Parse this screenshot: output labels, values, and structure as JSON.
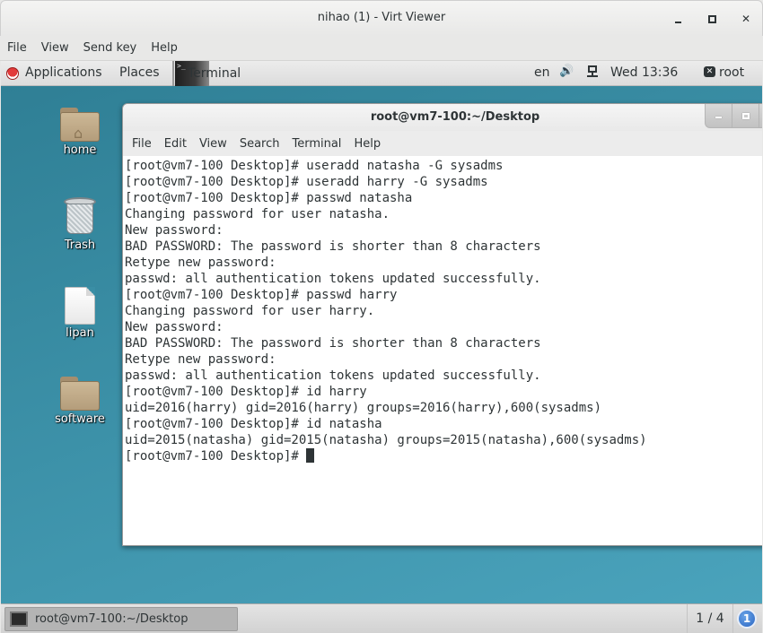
{
  "viewer": {
    "title": "nihao (1) - Virt Viewer",
    "menu": [
      "File",
      "View",
      "Send key",
      "Help"
    ],
    "controls": {
      "minimize": "minimize",
      "maximize": "maximize",
      "close": "close"
    }
  },
  "topbar": {
    "applications": "Applications",
    "places": "Places",
    "active_app": "Terminal",
    "terminal_icon_glyph": ">_",
    "language": "en",
    "clock": "Wed 13:36",
    "user": "root",
    "icons": [
      "redhat-logo-icon",
      "terminal-icon",
      "volume-icon",
      "network-wired-icon",
      "user-icon"
    ]
  },
  "desktop": {
    "icons": [
      {
        "label": "home",
        "type": "folder-home"
      },
      {
        "label": "Trash",
        "type": "trash"
      },
      {
        "label": "lipan",
        "type": "text-file"
      },
      {
        "label": "software",
        "type": "folder"
      }
    ]
  },
  "terminal": {
    "title": "root@vm7-100:~/Desktop",
    "menu": [
      "File",
      "Edit",
      "View",
      "Search",
      "Terminal",
      "Help"
    ],
    "lines": [
      "[root@vm7-100 Desktop]# useradd natasha -G sysadms",
      "[root@vm7-100 Desktop]# useradd harry -G sysadms",
      "[root@vm7-100 Desktop]# passwd natasha",
      "Changing password for user natasha.",
      "New password:",
      "BAD PASSWORD: The password is shorter than 8 characters",
      "Retype new password:",
      "passwd: all authentication tokens updated successfully.",
      "[root@vm7-100 Desktop]# passwd harry",
      "Changing password for user harry.",
      "New password:",
      "BAD PASSWORD: The password is shorter than 8 characters",
      "Retype new password:",
      "passwd: all authentication tokens updated successfully.",
      "[root@vm7-100 Desktop]# id harry",
      "uid=2016(harry) gid=2016(harry) groups=2016(harry),600(sysadms)",
      "[root@vm7-100 Desktop]# id natasha",
      "uid=2015(natasha) gid=2015(natasha) groups=2015(natasha),600(sysadms)"
    ],
    "prompt": "[root@vm7-100 Desktop]# "
  },
  "taskbar": {
    "window_button": "root@vm7-100:~/Desktop",
    "workspace": "1 / 4",
    "notification_count": "1"
  }
}
